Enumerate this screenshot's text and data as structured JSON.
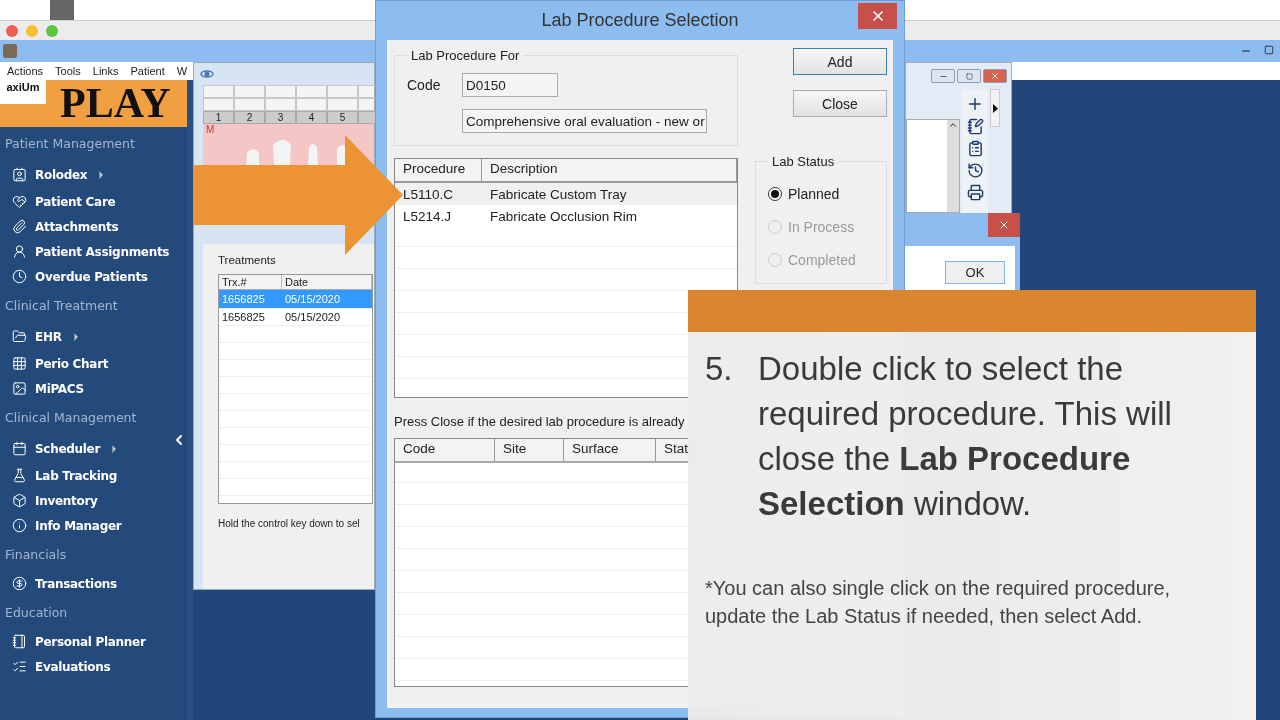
{
  "menu": [
    "Actions",
    "Tools",
    "Links",
    "Patient",
    "W"
  ],
  "logo": {
    "brand": "axiUm",
    "title": "PLAY"
  },
  "sidebar": {
    "sections": [
      {
        "title": "Patient Management",
        "items": [
          {
            "label": "Rolodex",
            "has_submenu": true
          },
          {
            "label": "Patient Care",
            "has_submenu": false
          },
          {
            "label": "Attachments",
            "has_submenu": false
          },
          {
            "label": "Patient Assignments",
            "has_submenu": false
          },
          {
            "label": "Overdue Patients",
            "has_submenu": false
          }
        ]
      },
      {
        "title": "Clinical Treatment",
        "items": [
          {
            "label": "EHR",
            "has_submenu": true
          },
          {
            "label": "Perio Chart",
            "has_submenu": false
          },
          {
            "label": "MiPACS",
            "has_submenu": false
          }
        ]
      },
      {
        "title": "Clinical Management",
        "items": [
          {
            "label": "Scheduler",
            "has_submenu": true
          },
          {
            "label": "Lab Tracking",
            "has_submenu": false
          },
          {
            "label": "Inventory",
            "has_submenu": false
          },
          {
            "label": "Info Manager",
            "has_submenu": false
          }
        ]
      },
      {
        "title": "Financials",
        "items": [
          {
            "label": "Transactions",
            "has_submenu": false
          }
        ]
      },
      {
        "title": "Education",
        "items": [
          {
            "label": "Personal Planner",
            "has_submenu": false
          },
          {
            "label": "Evaluations",
            "has_submenu": false
          }
        ]
      }
    ]
  },
  "chart_window": {
    "tooth_numbers": [
      "1",
      "2",
      "3",
      "4",
      "5"
    ],
    "arch_label": "M",
    "treatments": {
      "title": "Treatments",
      "columns": [
        "Trx.#",
        "Date"
      ],
      "rows": [
        {
          "cells": [
            "1656825",
            "05/15/2020"
          ],
          "selected": true
        },
        {
          "cells": [
            "1656825",
            "05/15/2020"
          ],
          "selected": false
        }
      ]
    },
    "hint": "Hold the control key down to sel"
  },
  "dialog": {
    "title": "Lab Procedure Selection",
    "group_title": "Lab Procedure For",
    "code_label": "Code",
    "code_value": "D0150",
    "description_value": "Comprehensive oral evaluation - new or",
    "buttons": [
      "Add",
      "Close"
    ],
    "procedures": {
      "columns": [
        "Procedure",
        "Description"
      ],
      "rows": [
        {
          "cells": [
            "L5110.C",
            "Fabricate Custom Tray"
          ],
          "selected": true
        },
        {
          "cells": [
            "L5214.J",
            "Fabricate Occlusion Rim"
          ],
          "selected": false
        }
      ]
    },
    "lab_status": {
      "title": "Lab Status",
      "options": [
        {
          "label": "Planned",
          "selected": true,
          "disabled": false
        },
        {
          "label": "In Process",
          "selected": false,
          "disabled": true
        },
        {
          "label": "Completed",
          "selected": false,
          "disabled": true
        }
      ]
    },
    "note": "Press Close if the desired lab procedure is already",
    "existing_columns": [
      "Code",
      "Site",
      "Surface",
      "Stat"
    ]
  },
  "message_dialog": {
    "button": "OK"
  },
  "instruction": {
    "step": "5.",
    "text": "Double click to select the required procedure. This will close the **Lab Procedure Selection** window.",
    "note": "*You can also single click on the required procedure, update the Lab Status if needed, then select Add."
  }
}
